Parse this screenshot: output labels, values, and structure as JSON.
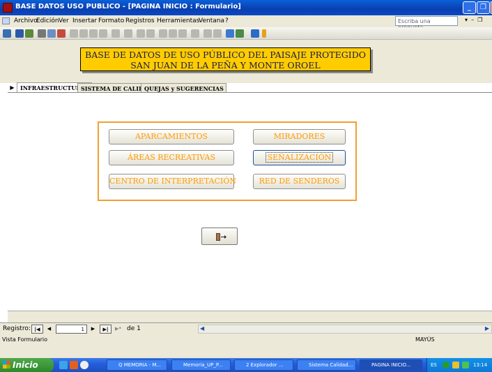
{
  "window": {
    "title": "BASE DATOS USO PUBLICO - [PAGINA INICIO : Formulario]"
  },
  "menu": {
    "items": [
      "Archivo",
      "Edición",
      "Ver",
      "Insertar",
      "Formato",
      "Registros",
      "Herramientas",
      "Ventana",
      "?"
    ],
    "help_placeholder": "Escriba una pregunta"
  },
  "form": {
    "banner_line1": "BASE DE DATOS DE USO PÚBLICO DEL PAISAJE PROTEGIDO",
    "banner_line2": "SAN JUAN DE LA PEÑA Y MONTE OROEL",
    "tabs": [
      "INFRAESTRUCTURAS",
      "SISTEMA DE CALIDAD",
      "QUEJAS y SUGERENCIAS"
    ],
    "buttons": {
      "aparcamientos": "APARCAMIENTOS",
      "miradores": "MIRADORES",
      "areas": "ÁREAS RECREATIVAS",
      "senalizacion": "SEÑALIZACIÓN",
      "centro": "CENTRO DE INTERPRETACIÓN",
      "senderos": "RED DE SENDEROS"
    },
    "exit_icon": "exit-door-icon"
  },
  "navigation": {
    "label": "Registro:",
    "current": "1",
    "of_text": "de 1"
  },
  "status": {
    "left": "Vista Formulario",
    "right": "MAYÚS"
  },
  "taskbar": {
    "start": "Inicio",
    "buttons": [
      "Q MEMORIA - M...",
      "Memoria_UP_P...",
      "2 Explorador ...",
      "Sistema Calidad...",
      "PAGINA INICIO..."
    ],
    "lang": "ES",
    "clock": "13:14"
  },
  "colors": {
    "banner": "#ffcc00",
    "button_text": "#ff9900",
    "panel_border": "#f0a030",
    "titlebar": "#0a3fb0"
  }
}
